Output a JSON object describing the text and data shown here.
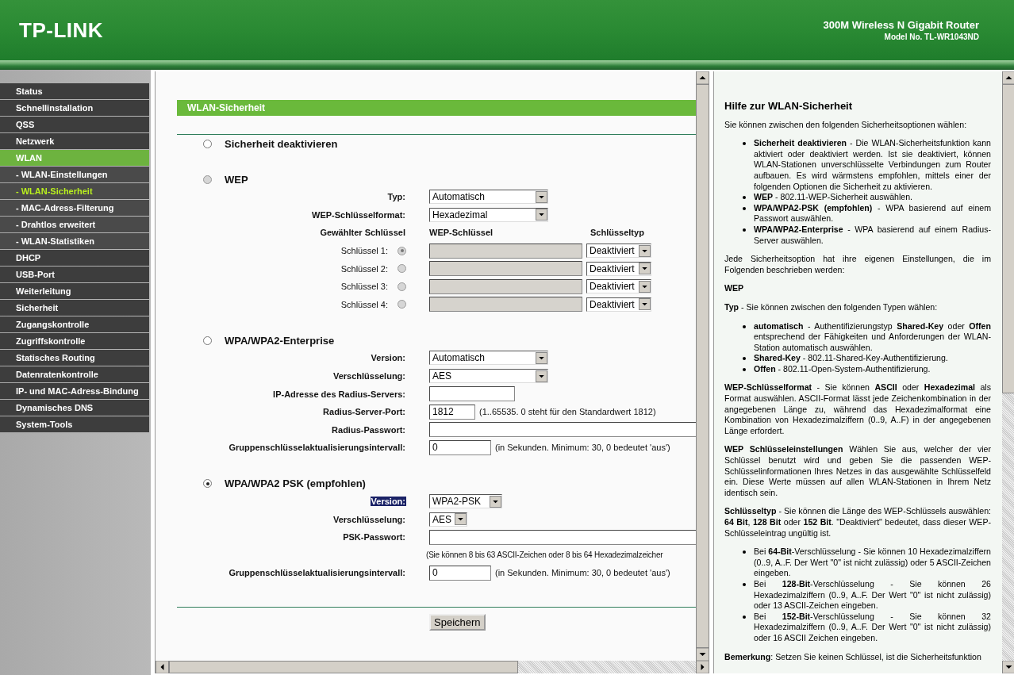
{
  "header": {
    "logo": "TP-LINK",
    "product": "300M Wireless N Gigabit Router",
    "model": "Model No. TL-WR1043ND"
  },
  "sidebar": {
    "items": [
      {
        "label": "Status",
        "kind": "main",
        "selected": false
      },
      {
        "label": "Schnellinstallation",
        "kind": "main",
        "selected": false
      },
      {
        "label": "QSS",
        "kind": "main",
        "selected": false
      },
      {
        "label": "Netzwerk",
        "kind": "main",
        "selected": false
      },
      {
        "label": "WLAN",
        "kind": "main",
        "selected": true
      },
      {
        "label": "- WLAN-Einstellungen",
        "kind": "sub",
        "selected": false
      },
      {
        "label": "- WLAN-Sicherheit",
        "kind": "sub",
        "selected": true
      },
      {
        "label": "- MAC-Adress-Filterung",
        "kind": "sub",
        "selected": false
      },
      {
        "label": "- Drahtlos erweitert",
        "kind": "sub",
        "selected": false
      },
      {
        "label": "- WLAN-Statistiken",
        "kind": "sub",
        "selected": false
      },
      {
        "label": "DHCP",
        "kind": "main",
        "selected": false
      },
      {
        "label": "USB-Port",
        "kind": "main",
        "selected": false
      },
      {
        "label": "Weiterleitung",
        "kind": "main",
        "selected": false
      },
      {
        "label": "Sicherheit",
        "kind": "main",
        "selected": false
      },
      {
        "label": "Zugangskontrolle",
        "kind": "main",
        "selected": false
      },
      {
        "label": "Zugriffskontrolle",
        "kind": "main",
        "selected": false
      },
      {
        "label": "Statisches Routing",
        "kind": "main",
        "selected": false
      },
      {
        "label": "Datenratenkontrolle",
        "kind": "main",
        "selected": false
      },
      {
        "label": "IP- und MAC-Adress-Bindung",
        "kind": "main",
        "selected": false
      },
      {
        "label": "Dynamisches DNS",
        "kind": "main",
        "selected": false
      },
      {
        "label": "System-Tools",
        "kind": "main",
        "selected": false
      }
    ]
  },
  "main": {
    "title": "WLAN-Sicherheit",
    "options": [
      {
        "label": "Sicherheit deaktivieren",
        "selected": false,
        "disabled": false
      },
      {
        "label": "WEP",
        "selected": false,
        "disabled": true,
        "fields": [
          {
            "label": "Typ:",
            "kind": "select",
            "value": "Automatisch",
            "highlighted": false
          },
          {
            "label": "WEP-Schlüsselformat:",
            "kind": "select",
            "value": "Hexadezimal",
            "highlighted": false
          }
        ],
        "key_headers": [
          "Gewählter Schlüssel",
          "WEP-Schlüssel",
          "Schlüsseltyp"
        ],
        "keys": [
          {
            "label": "Schlüssel 1:",
            "selected": true,
            "type": "Deaktiviert"
          },
          {
            "label": "Schlüssel 2:",
            "selected": false,
            "type": "Deaktiviert"
          },
          {
            "label": "Schlüssel 3:",
            "selected": false,
            "type": "Deaktiviert"
          },
          {
            "label": "Schlüssel 4:",
            "selected": false,
            "type": "Deaktiviert"
          }
        ]
      },
      {
        "label": "WPA/WPA2-Enterprise",
        "selected": false,
        "disabled": false,
        "fields": [
          {
            "label": "Version:",
            "kind": "select",
            "value": "Automatisch",
            "highlighted": false
          },
          {
            "label": "Verschlüsselung:",
            "kind": "select",
            "value": "AES",
            "highlighted": false
          },
          {
            "label": "IP-Adresse des Radius-Servers:",
            "kind": "input",
            "highlighted": false
          },
          {
            "label": "Radius-Server-Port:",
            "kind": "input",
            "value": "1812",
            "note": "(1..65535. 0 steht für den Standardwert 1812)",
            "highlighted": false
          },
          {
            "label": "Radius-Passwort:",
            "kind": "input",
            "highlighted": false
          },
          {
            "label": "Gruppenschlüsselaktualisierungsintervall:",
            "kind": "input",
            "value": "0",
            "note": "(in Sekunden. Minimum: 30, 0 bedeutet 'aus')",
            "highlighted": false
          }
        ]
      },
      {
        "label": "WPA/WPA2 PSK (empfohlen)",
        "selected": true,
        "disabled": false,
        "fields": [
          {
            "label": "Version:",
            "kind": "select",
            "value": "WPA2-PSK",
            "highlighted": true
          },
          {
            "label": "Verschlüsselung:",
            "kind": "select",
            "value": "AES",
            "highlighted": false
          },
          {
            "label": "PSK-Passwort:",
            "kind": "input",
            "highlighted": false
          },
          {
            "kind": "note",
            "note": "(Sie können 8 bis 63 ASCII-Zeichen oder 8 bis 64 Hexadezimalzeicher"
          },
          {
            "label": "Gruppenschlüsselaktualisierungsintervall:",
            "kind": "input",
            "value": "0",
            "note": "(in Sekunden. Minimum: 30, 0 bedeutet 'aus')",
            "highlighted": false
          }
        ]
      }
    ],
    "save": "Speichern"
  },
  "help": {
    "title": "Hilfe zur WLAN-Sicherheit",
    "blocks": [
      {
        "kind": "p",
        "text": "Sie können zwischen den folgenden Sicherheitsoptionen wählen:"
      },
      {
        "kind": "list",
        "items": [
          "**Sicherheit deaktivieren** - Die WLAN-Sicherheitsfunktion kann aktiviert oder deaktiviert werden. Ist sie deaktiviert, können WLAN-Stationen unverschlüsselte Verbindungen zum Router aufbauen. Es wird wärmstens empfohlen, mittels einer der folgenden Optionen die Sicherheit zu aktivieren.",
          "**WEP** - 802.11-WEP-Sicherheit auswählen.",
          "**WPA/WPA2-PSK (empfohlen)** - WPA basierend auf einem Passwort auswählen.",
          "**WPA/WPA2-Enterprise** - WPA basierend auf einem Radius-Server auswählen."
        ]
      },
      {
        "kind": "p",
        "text": "Jede Sicherheitsoption hat ihre eigenen Einstellungen, die im Folgenden beschrieben werden:"
      },
      {
        "kind": "h",
        "text": "WEP"
      },
      {
        "kind": "p",
        "text": "**Typ** - Sie können zwischen den folgenden Typen wählen:"
      },
      {
        "kind": "list",
        "items": [
          "**automatisch** - Authentifizierungstyp **Shared-Key** oder **Offen** entsprechend der Fähigkeiten und Anforderungen der WLAN-Station automatisch auswählen.",
          "**Shared-Key** - 802.11-Shared-Key-Authentifizierung.",
          "**Offen** - 802.11-Open-System-Authentifizierung."
        ]
      },
      {
        "kind": "p",
        "text": "**WEP-Schlüsselformat** - Sie können **ASCII** oder **Hexadezimal** als Format auswählen. ASCII-Format lässt jede Zeichenkombination in der angegebenen Länge zu, während das Hexadezimalformat eine Kombination von Hexadezimalziffern (0..9, A..F) in der angegebenen Länge erfordert."
      },
      {
        "kind": "p",
        "text": "**WEP Schlüsseleinstellungen** Wählen Sie aus, welcher der vier Schlüssel benutzt wird und geben Sie die passenden WEP-Schlüsselinformationen Ihres Netzes in das ausgewählte Schlüsselfeld ein. Diese Werte müssen auf allen WLAN-Stationen in Ihrem Netz identisch sein."
      },
      {
        "kind": "p",
        "text": "**Schlüsseltyp** - Sie können die Länge des WEP-Schlüssels auswählen: **64 Bit**, **128 Bit** oder **152 Bit**. \"Deaktiviert\" bedeutet, dass dieser WEP-Schlüsseleintrag ungültig ist."
      },
      {
        "kind": "list",
        "items": [
          "Bei **64-Bit**-Verschlüsselung - Sie können 10 Hexadezimalziffern (0..9, A..F. Der Wert \"0\" ist nicht zulässig) oder 5 ASCII-Zeichen eingeben.",
          "Bei **128-Bit**-Verschlüsselung - Sie können 26 Hexadezimalziffern (0..9, A..F. Der Wert \"0\" ist nicht zulässig) oder 13 ASCII-Zeichen eingeben.",
          "Bei **152-Bit**-Verschlüsselung - Sie können 32 Hexadezimalziffern (0..9, A..F. Der Wert \"0\" ist nicht zulässig) oder 16 ASCII Zeichen eingeben."
        ]
      },
      {
        "kind": "p",
        "text": "**Bemerkung**: Setzen Sie keinen Schlüssel, ist die Sicherheitsfunktion"
      }
    ]
  }
}
